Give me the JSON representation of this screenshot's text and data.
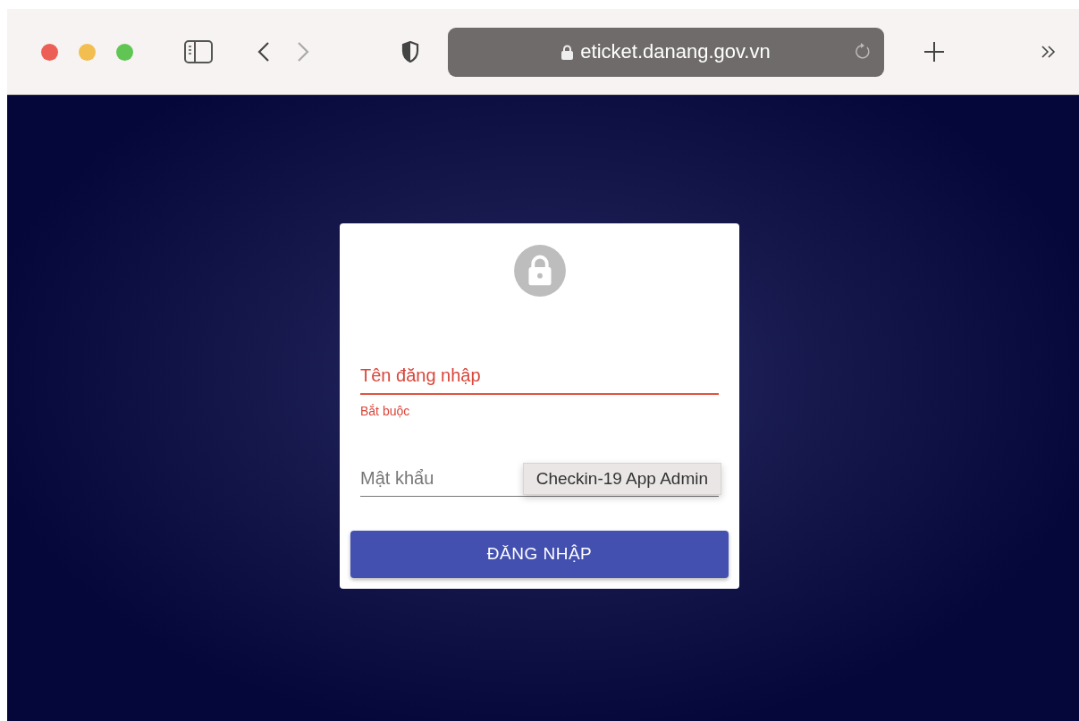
{
  "browser": {
    "url": "eticket.danang.gov.vn"
  },
  "login": {
    "fields": [
      {
        "kind": "text",
        "label": "Tên đăng nhập",
        "error": true,
        "helper": "Bắt buộc"
      },
      {
        "kind": "password",
        "label": "Mật khẩu",
        "error": false
      }
    ],
    "tooltip": "Checkin-19 App Admin",
    "submit": "ĐĂNG NHẬP"
  }
}
